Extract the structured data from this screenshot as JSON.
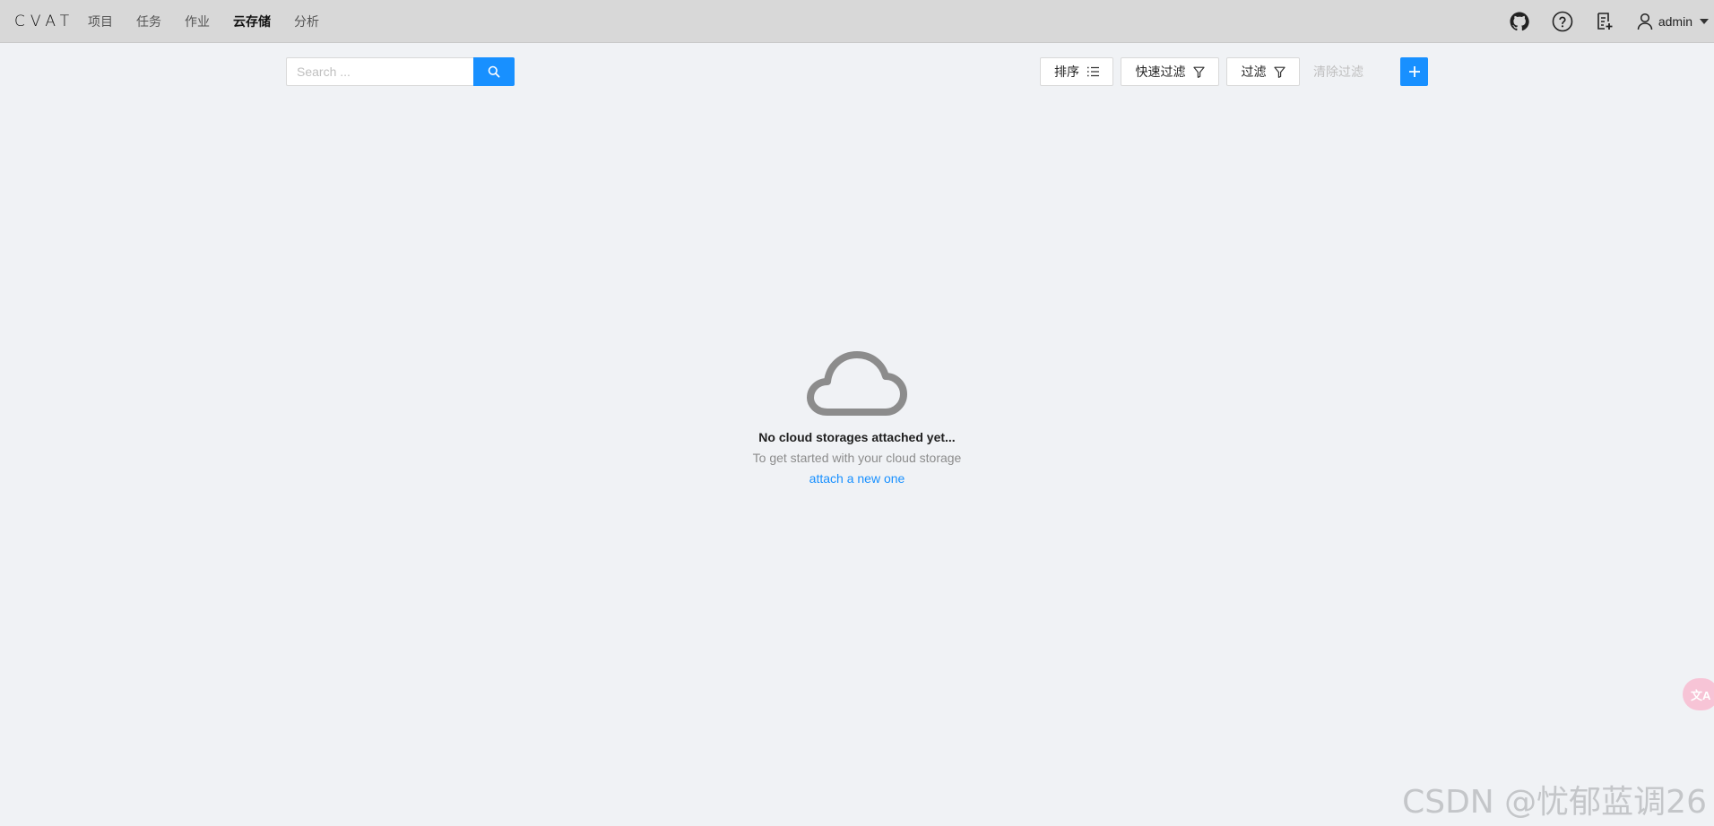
{
  "header": {
    "logo": "CVAT",
    "nav": [
      "项目",
      "任务",
      "作业",
      "云存储",
      "分析"
    ],
    "active_nav": "云存储",
    "user": "admin"
  },
  "toolbar": {
    "search_placeholder": "Search ...",
    "sort_label": "排序",
    "quick_filter_label": "快速过滤",
    "filter_label": "过滤",
    "clear_filter_label": "清除过滤"
  },
  "empty_state": {
    "title": "No cloud storages attached yet...",
    "subtitle": "To get started with your cloud storage",
    "link": "attach a new one"
  },
  "floating": {
    "translate_badge": "文A"
  },
  "watermark": "CSDN @忧郁蓝调26",
  "colors": {
    "primary": "#1890ff",
    "header_bg": "#d8d8d8",
    "page_bg": "#f0f2f5"
  }
}
